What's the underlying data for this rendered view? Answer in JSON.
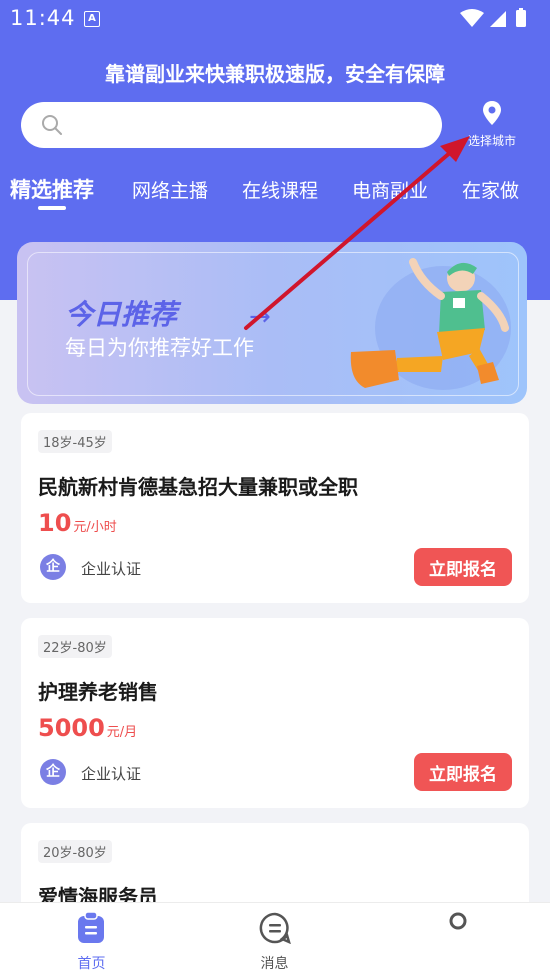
{
  "status_bar": {
    "time": "11:44",
    "notification_badge": "A"
  },
  "header": {
    "headline": "靠谱副业来快兼职极速版，安全有保障"
  },
  "search": {
    "placeholder": ""
  },
  "city_selector": {
    "label": "选择城市"
  },
  "tabs": [
    {
      "label": "精选推荐",
      "active": true
    },
    {
      "label": "网络主播"
    },
    {
      "label": "在线课程"
    },
    {
      "label": "电商副业"
    },
    {
      "label": "在家做"
    }
  ],
  "banner": {
    "title": "今日推荐",
    "subtitle": "每日为你推荐好工作"
  },
  "jobs": [
    {
      "age": "18岁-45岁",
      "title": "民航新村肯德基急招大量兼职或全职",
      "salary": "10",
      "unit": "元/小时",
      "cert": "企业认证",
      "cert_icon": "企",
      "apply": "立即报名"
    },
    {
      "age": "22岁-80岁",
      "title": "护理养老销售",
      "salary": "5000",
      "unit": "元/月",
      "cert": "企业认证",
      "cert_icon": "企",
      "apply": "立即报名"
    },
    {
      "age": "20岁-80岁",
      "title": "爱情海服务员"
    }
  ],
  "bottom_nav": [
    {
      "label": "首页",
      "icon": "home-clipboard-icon",
      "active": true
    },
    {
      "label": "消息",
      "icon": "message-icon"
    },
    {
      "label": "",
      "icon": "profile-icon"
    }
  ],
  "colors": {
    "primary": "#5e6df0",
    "accent_red": "#f05555",
    "annotation_arrow": "#d0162c"
  }
}
